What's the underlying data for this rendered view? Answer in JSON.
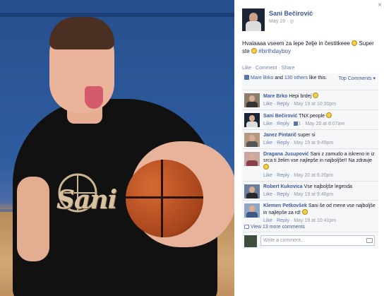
{
  "photo": {
    "logo_text": "Sani"
  },
  "post": {
    "author": "Sani Bečirović",
    "date": "May 19",
    "text_part1": "Hvalaaaa vseem za lepe želje in čestitkeee ",
    "text_part2": " Super ste ",
    "hashtag": "#birthdayboy",
    "actions": {
      "like": "Like",
      "comment": "Comment",
      "share": "Share"
    },
    "likes": {
      "names": "Mare Brko",
      "and": "and",
      "others": "130 others",
      "suffix": "like this."
    },
    "top_comments": "Top Comments ▾",
    "close": "×"
  },
  "comments": [
    {
      "name": "Mare Brko",
      "text": "Hepi brdej ",
      "emoji": true,
      "like": "Like",
      "reply": "Reply",
      "time": "May 19 at 10:30pm",
      "count": ""
    },
    {
      "name": "Sani Bečirović",
      "text": "TNX people ",
      "emoji": true,
      "like": "Like",
      "reply": "Reply",
      "time": "May 20 at 8:07am",
      "count": "1"
    },
    {
      "name": "Janez Pintarič",
      "text": "super si",
      "emoji": false,
      "like": "Like",
      "reply": "Reply",
      "time": "May 19 at 9:49pm",
      "count": ""
    },
    {
      "name": "Dragana Jusupović",
      "text": "Sani z zamudo a iskreno in iz srca ti želim vse najlepše in najboljše!! Na zdravje ",
      "emoji": true,
      "like": "Like",
      "reply": "Reply",
      "time": "May 20 at 6:20pm",
      "count": ""
    },
    {
      "name": "Robert Kukovica",
      "text": "Vse najboljše legenda",
      "emoji": false,
      "like": "Like",
      "reply": "Reply",
      "time": "May 19 at 9:46pm",
      "count": ""
    },
    {
      "name": "Klemen Petkovšek",
      "text": "Sani še od mene vse najboljše in najlepše za rd! ",
      "emoji": true,
      "like": "Like",
      "reply": "Reply",
      "time": "May 19 at 10:41pm",
      "count": ""
    }
  ],
  "more_comments": "View 13 more comments",
  "write_placeholder": "Write a comment...",
  "colors": {
    "link": "#3b5998",
    "meta": "#9197a3",
    "panel_bg": "#f6f7f9"
  },
  "icons": [
    "globe-icon",
    "thumbs-up-icon",
    "smiley-icon",
    "comment-icon",
    "camera-icon",
    "close-icon"
  ]
}
